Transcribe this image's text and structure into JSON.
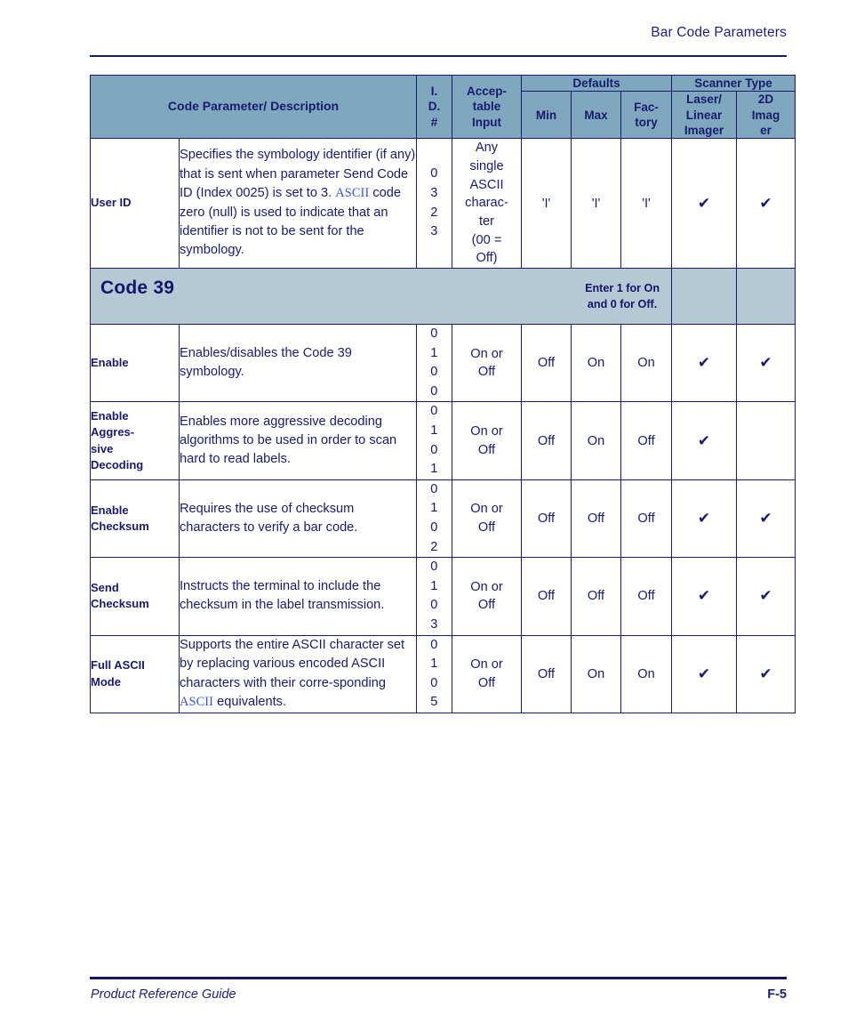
{
  "header": {
    "title": "Bar Code Parameters"
  },
  "table": {
    "columns": {
      "description": "Code Parameter/ Description",
      "id": "I.\nD.\n#",
      "id_line1": "I.",
      "id_line2": "D.",
      "id_line3": "#",
      "acceptable_input": "Accep-\ntable\nInput",
      "acceptable_line1": "Accep-",
      "acceptable_line2": "table",
      "acceptable_line3": "Input",
      "defaults_group": "Defaults",
      "scanner_group": "Scanner Type",
      "min": "Min",
      "max": "Max",
      "factory_line1": "Fac-",
      "factory_line2": "tory",
      "laser_line1": "Laser/",
      "laser_line2": "Linear",
      "laser_line3": "Imager",
      "imager_line1": "2D",
      "imager_line2": "Imag",
      "imager_line3": "er"
    },
    "rows": [
      {
        "name": "User ID",
        "desc_pre": "Specifies the symbology identifier (if any) that is sent when parameter Send Code ID (Index 0025) is set to 3. ",
        "desc_xref": "ASCII",
        "desc_post": " code zero (null) is used to indicate that an identifier is not to be sent for the symbology.",
        "id_digits": [
          "0",
          "3",
          "2",
          "3"
        ],
        "input_lines": [
          "Any",
          "single",
          "ASCII",
          "charac-",
          "ter",
          "(00 =",
          "Off)"
        ],
        "min": "'I'",
        "max": "'I'",
        "factory": "'I'",
        "laser": "✔",
        "imager": "✔"
      },
      {
        "name": "Enable",
        "desc_pre": "Enables/disables the Code 39 symbology.",
        "desc_xref": "",
        "desc_post": "",
        "id_digits": [
          "0",
          "1",
          "0",
          "0"
        ],
        "input_lines": [
          "On or",
          "Off"
        ],
        "min": "Off",
        "max": "On",
        "factory": "On",
        "laser": "✔",
        "imager": "✔"
      },
      {
        "name": "Enable Aggres- sive Decoding",
        "name_lines": [
          "Enable",
          "Aggres-",
          "sive",
          "Decoding"
        ],
        "desc_pre": "Enables more aggressive decoding algorithms to be used in order to scan hard to read labels.",
        "desc_xref": "",
        "desc_post": "",
        "id_digits": [
          "0",
          "1",
          "0",
          "1"
        ],
        "input_lines": [
          "On or",
          "Off"
        ],
        "min": "Off",
        "max": "On",
        "factory": "Off",
        "laser": "✔",
        "imager": ""
      },
      {
        "name": "Enable Checksum",
        "name_lines": [
          "Enable",
          "Checksum"
        ],
        "desc_pre": "Requires the use of checksum characters to verify a bar code.",
        "desc_xref": "",
        "desc_post": "",
        "id_digits": [
          "0",
          "1",
          "0",
          "2"
        ],
        "input_lines": [
          "On or",
          "Off"
        ],
        "min": "Off",
        "max": "Off",
        "factory": "Off",
        "laser": "✔",
        "imager": "✔"
      },
      {
        "name": "Send Checksum",
        "name_lines": [
          "Send",
          "Checksum"
        ],
        "desc_pre": "Instructs the terminal to include the checksum in the label transmission.",
        "desc_xref": "",
        "desc_post": "",
        "id_digits": [
          "0",
          "1",
          "0",
          "3"
        ],
        "input_lines": [
          "On or",
          "Off"
        ],
        "min": "Off",
        "max": "Off",
        "factory": "Off",
        "laser": "✔",
        "imager": "✔"
      },
      {
        "name": "Full ASCII Mode",
        "name_lines": [
          "Full ASCII",
          "Mode"
        ],
        "desc_pre": "Supports the entire ASCII character set by replacing various encoded ASCII characters with their corre-sponding ",
        "desc_xref": "ASCII",
        "desc_post": " equivalents.",
        "id_digits": [
          "0",
          "1",
          "0",
          "5"
        ],
        "input_lines": [
          "On or",
          "Off"
        ],
        "min": "Off",
        "max": "On",
        "factory": "On",
        "laser": "✔",
        "imager": "✔"
      }
    ],
    "section_band": {
      "title": "Code 39",
      "note_line1": "Enter 1 for On",
      "note_line2": "and 0 for Off."
    }
  },
  "footer": {
    "left": "Product Reference Guide",
    "right": "F-5"
  },
  "colors": {
    "header_fill": "#7fa8be",
    "band_fill": "#b4c9d4",
    "ink": "#1a1a6e",
    "xref": "#3a54d8"
  }
}
